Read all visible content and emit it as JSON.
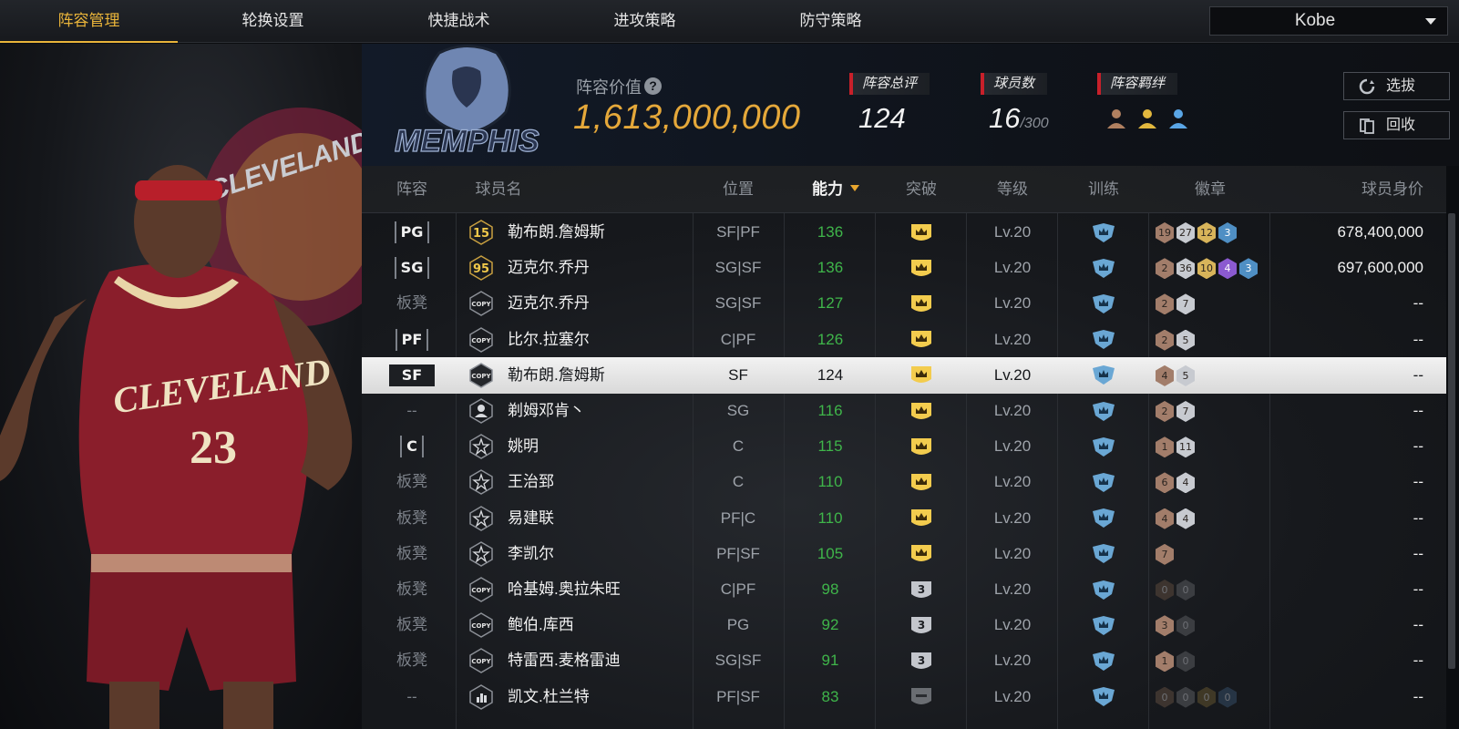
{
  "tabs": [
    "阵容管理",
    "轮换设置",
    "快捷战术",
    "进攻策略",
    "防守策略"
  ],
  "active_tab": 0,
  "user_select": "Kobe",
  "header": {
    "value_label": "阵容价值",
    "value": "1,613,000,000",
    "rating_label": "阵容总评",
    "rating": "124",
    "count_label": "球员数",
    "count": "16",
    "count_max": "/300",
    "bond_label": "阵容羁绊",
    "select_button": "选拔",
    "recycle_button": "回收",
    "logo_text": "MEMPHIS"
  },
  "art": {
    "jersey_team": "CLEVELAND",
    "jersey_number": "23",
    "bg_text": "CLEVELAND"
  },
  "columns": [
    "阵容",
    "球员名",
    "位置",
    "能力",
    "突破",
    "等级",
    "训练",
    "徽章",
    "球员身价"
  ],
  "rows": [
    {
      "role": "PG",
      "start": true,
      "icon": "card-15",
      "icon_text": "15",
      "name": "勒布朗.詹姆斯",
      "pos": "SF|PF",
      "power": "136",
      "breakthrough": "crown",
      "level": "Lv.20",
      "badges": [
        [
          "19",
          "bronze"
        ],
        [
          "27",
          "silver"
        ],
        [
          "12",
          "gold"
        ],
        [
          "3",
          "blue"
        ]
      ],
      "value": "678,400,000"
    },
    {
      "role": "SG",
      "start": true,
      "icon": "card-95",
      "icon_text": "95",
      "name": "迈克尔.乔丹",
      "pos": "SG|SF",
      "power": "136",
      "breakthrough": "crown",
      "level": "Lv.20",
      "badges": [
        [
          "2",
          "bronze"
        ],
        [
          "36",
          "silver"
        ],
        [
          "10",
          "gold"
        ],
        [
          "4",
          "purple"
        ],
        [
          "3",
          "blue"
        ]
      ],
      "value": "697,600,000"
    },
    {
      "role": "板凳",
      "start": false,
      "icon": "copy",
      "icon_text": "COPY",
      "name": "迈克尔.乔丹",
      "pos": "SG|SF",
      "power": "127",
      "breakthrough": "crown",
      "level": "Lv.20",
      "badges": [
        [
          "2",
          "bronze"
        ],
        [
          "7",
          "silver"
        ]
      ],
      "value": "--"
    },
    {
      "role": "PF",
      "start": true,
      "icon": "copy",
      "icon_text": "COPY",
      "name": "比尔.拉塞尔",
      "pos": "C|PF",
      "power": "126",
      "breakthrough": "crown",
      "level": "Lv.20",
      "badges": [
        [
          "2",
          "bronze"
        ],
        [
          "5",
          "silver"
        ]
      ],
      "value": "--"
    },
    {
      "role": "SF",
      "start": true,
      "selected": true,
      "icon": "copy",
      "icon_text": "COPY",
      "name": "勒布朗.詹姆斯",
      "pos": "SF",
      "power": "124",
      "breakthrough": "crown",
      "level": "Lv.20",
      "badges": [
        [
          "4",
          "bronze"
        ],
        [
          "5",
          "silver"
        ]
      ],
      "value": "--"
    },
    {
      "role": "--",
      "start": false,
      "icon": "person",
      "icon_text": "",
      "name": "剃姆邓肯丶",
      "pos": "SG",
      "power": "116",
      "breakthrough": "crown",
      "level": "Lv.20",
      "badges": [
        [
          "2",
          "bronze"
        ],
        [
          "7",
          "silver"
        ]
      ],
      "value": "--"
    },
    {
      "role": "C",
      "start": true,
      "icon": "star",
      "icon_text": "",
      "name": "姚明",
      "pos": "C",
      "power": "115",
      "breakthrough": "crown",
      "level": "Lv.20",
      "badges": [
        [
          "1",
          "bronze"
        ],
        [
          "11",
          "silver"
        ]
      ],
      "value": "--"
    },
    {
      "role": "板凳",
      "start": false,
      "icon": "star",
      "icon_text": "",
      "name": "王治郅",
      "pos": "C",
      "power": "110",
      "breakthrough": "crown",
      "level": "Lv.20",
      "badges": [
        [
          "6",
          "bronze"
        ],
        [
          "4",
          "silver"
        ]
      ],
      "value": "--"
    },
    {
      "role": "板凳",
      "start": false,
      "icon": "star",
      "icon_text": "",
      "name": "易建联",
      "pos": "PF|C",
      "power": "110",
      "breakthrough": "crown",
      "level": "Lv.20",
      "badges": [
        [
          "4",
          "bronze"
        ],
        [
          "4",
          "silver"
        ]
      ],
      "value": "--"
    },
    {
      "role": "板凳",
      "start": false,
      "icon": "star",
      "icon_text": "",
      "name": "李凯尔",
      "pos": "PF|SF",
      "power": "105",
      "breakthrough": "crown",
      "level": "Lv.20",
      "badges": [
        [
          "7",
          "bronze"
        ]
      ],
      "value": "--"
    },
    {
      "role": "板凳",
      "start": false,
      "icon": "copy",
      "icon_text": "COPY",
      "name": "哈基姆.奥拉朱旺",
      "pos": "C|PF",
      "power": "98",
      "breakthrough": "3",
      "level": "Lv.20",
      "badges": [
        [
          "0",
          "dark"
        ],
        [
          "0",
          "dark-silver"
        ]
      ],
      "value": "--"
    },
    {
      "role": "板凳",
      "start": false,
      "icon": "copy",
      "icon_text": "COPY",
      "name": "鲍伯.库西",
      "pos": "PG",
      "power": "92",
      "breakthrough": "3",
      "level": "Lv.20",
      "badges": [
        [
          "3",
          "bronze"
        ],
        [
          "0",
          "dark-silver"
        ]
      ],
      "value": "--"
    },
    {
      "role": "板凳",
      "start": false,
      "icon": "copy",
      "icon_text": "COPY",
      "name": "特雷西.麦格雷迪",
      "pos": "SG|SF",
      "power": "91",
      "breakthrough": "3",
      "level": "Lv.20",
      "badges": [
        [
          "1",
          "bronze"
        ],
        [
          "0",
          "dark-silver"
        ]
      ],
      "value": "--"
    },
    {
      "role": "--",
      "start": false,
      "icon": "bars",
      "icon_text": "",
      "name": "凯文.杜兰特",
      "pos": "PF|SF",
      "power": "83",
      "breakthrough": "empty",
      "level": "Lv.20",
      "badges": [
        [
          "0",
          "dark"
        ],
        [
          "0",
          "dark-silver"
        ],
        [
          "0",
          "dark-gold"
        ],
        [
          "0",
          "dark-blue"
        ]
      ],
      "value": "--"
    }
  ],
  "colors": {
    "accent": "#e9b43a",
    "power_green": "#3fb54a",
    "bronze": "#a27d6a",
    "silver": "#c7cad0",
    "gold": "#d8b45a",
    "purple": "#8b5ad0",
    "blue": "#4f8fc4",
    "training_blue": "#6aa7d4",
    "crown_yellow": "#f3cc4e"
  }
}
